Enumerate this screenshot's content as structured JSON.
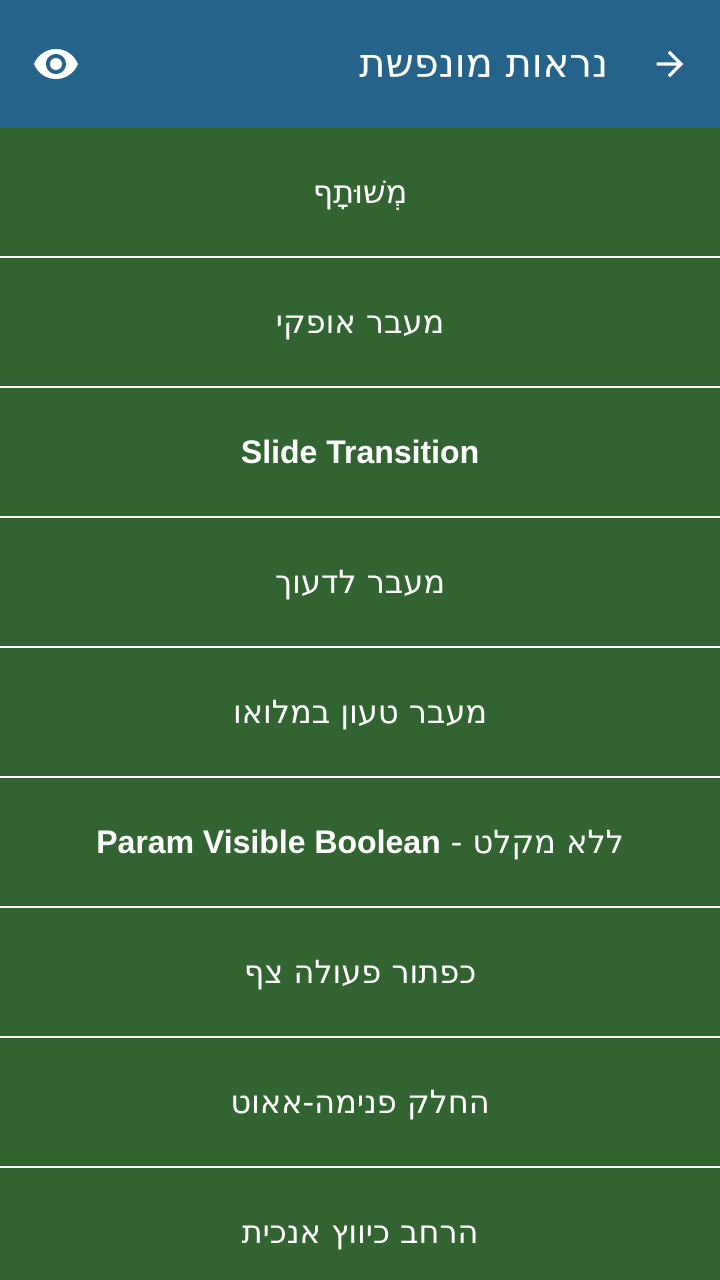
{
  "header": {
    "title": "נראות מונפשת",
    "back_icon": "arrow-right-icon",
    "action_icon": "eye-icon"
  },
  "colors": {
    "header_bg": "#26638a",
    "list_bg": "#316430",
    "text": "#ffffff",
    "divider": "#ffffff"
  },
  "items": [
    {
      "label": "מְשׁוּתָף"
    },
    {
      "label": "מעבר אופקי"
    },
    {
      "label": "Slide Transition"
    },
    {
      "label": "מעבר לדעוך"
    },
    {
      "label": "מעבר טעון במלואו"
    },
    {
      "label_latin": "Param Visible Boolean",
      "label_hebrew": "ללא מקלט"
    },
    {
      "label": "כפתור פעולה צף"
    },
    {
      "label": "החלק פנימה-אאוט"
    },
    {
      "label": "הרחב כיווץ אנכית"
    }
  ]
}
